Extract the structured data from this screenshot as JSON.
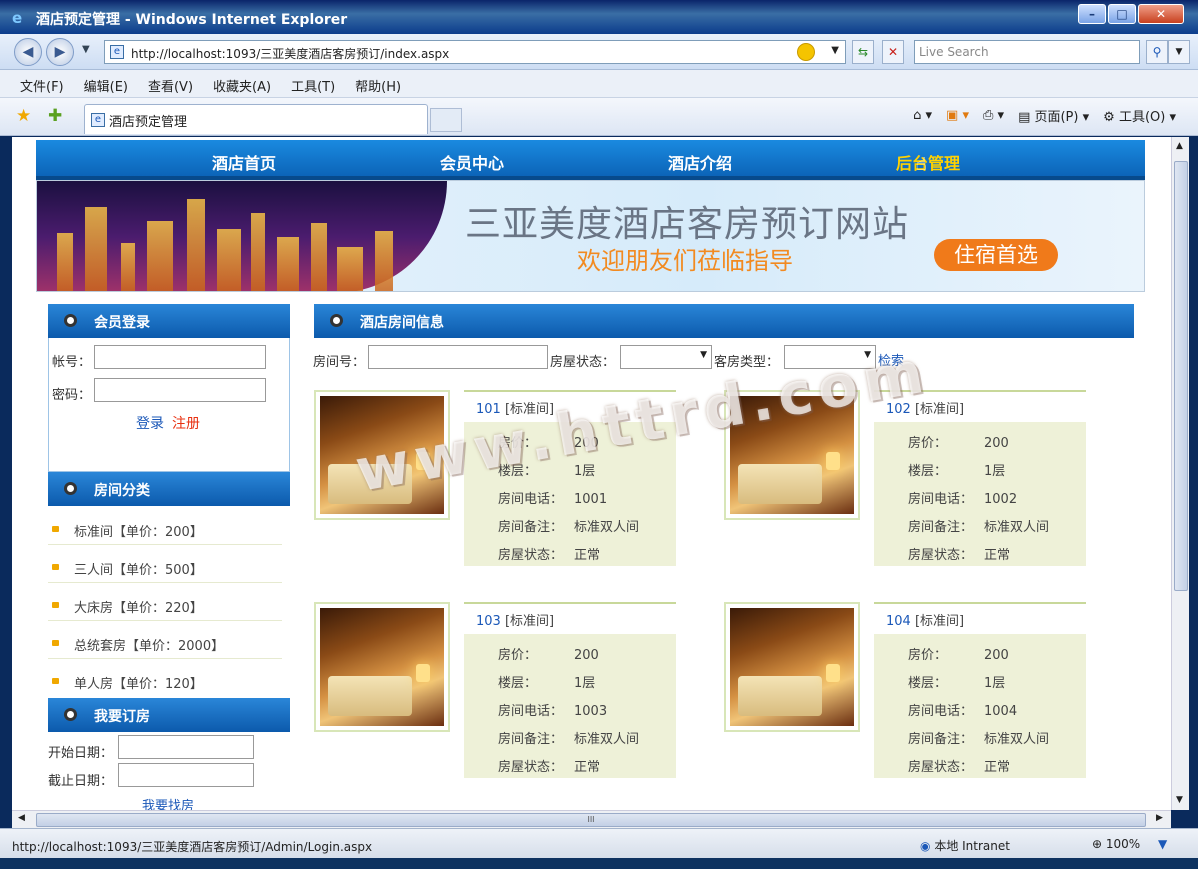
{
  "window": {
    "title": "酒店预定管理 - Windows Internet Explorer"
  },
  "browser": {
    "url": "http://localhost:1093/三亚美度酒店客房预订/index.aspx",
    "search_placeholder": "Live Search",
    "menu": [
      "文件(F)",
      "编辑(E)",
      "查看(V)",
      "收藏夹(A)",
      "工具(T)",
      "帮助(H)"
    ],
    "tab_title": "酒店预定管理",
    "cmd_page": "页面(P)",
    "cmd_tools": "工具(O)"
  },
  "status": {
    "link": "http://localhost:1093/三亚美度酒店客房预订/Admin/Login.aspx",
    "zone": "本地 Intranet",
    "zoom": "100%"
  },
  "site": {
    "nav": [
      "酒店首页",
      "会员中心",
      "酒店介绍",
      "后台管理"
    ],
    "banner_title": "三亚美度酒店客房预订网站",
    "banner_sub": "欢迎朋友们莅临指导",
    "banner_pill": "住宿首选"
  },
  "login": {
    "heading": "会员登录",
    "account_label": "帐号：",
    "password_label": "密码：",
    "login": "登录",
    "register": "注册"
  },
  "categories": {
    "heading": "房间分类",
    "items": [
      "标准间【单价：200】",
      "三人间【单价：500】",
      "大床房【单价：220】",
      "总统套房【单价：2000】",
      "单人房【单价：120】"
    ]
  },
  "booking": {
    "heading": "我要订房",
    "start_label": "开始日期：",
    "end_label": "截止日期：",
    "search": "我要找房"
  },
  "main": {
    "heading": "酒店房间信息",
    "filter_room_no": "房间号：",
    "filter_status": "房屋状态：",
    "filter_type": "客房类型：",
    "search": "检索",
    "labels": {
      "price": "房价：",
      "floor": "楼层：",
      "phone": "房间电话：",
      "note": "房间备注：",
      "status": "房屋状态："
    },
    "rooms": [
      {
        "no": "101",
        "type": "[标准间]",
        "price": "200",
        "floor": "1层",
        "phone": "1001",
        "note": "标准双人间",
        "status": "正常"
      },
      {
        "no": "102",
        "type": "[标准间]",
        "price": "200",
        "floor": "1层",
        "phone": "1002",
        "note": "标准双人间",
        "status": "正常"
      },
      {
        "no": "103",
        "type": "[标准间]",
        "price": "200",
        "floor": "1层",
        "phone": "1003",
        "note": "标准双人间",
        "status": "正常"
      },
      {
        "no": "104",
        "type": "[标准间]",
        "price": "200",
        "floor": "1层",
        "phone": "1004",
        "note": "标准双人间",
        "status": "正常"
      }
    ]
  },
  "watermark": "www.httrd.com"
}
